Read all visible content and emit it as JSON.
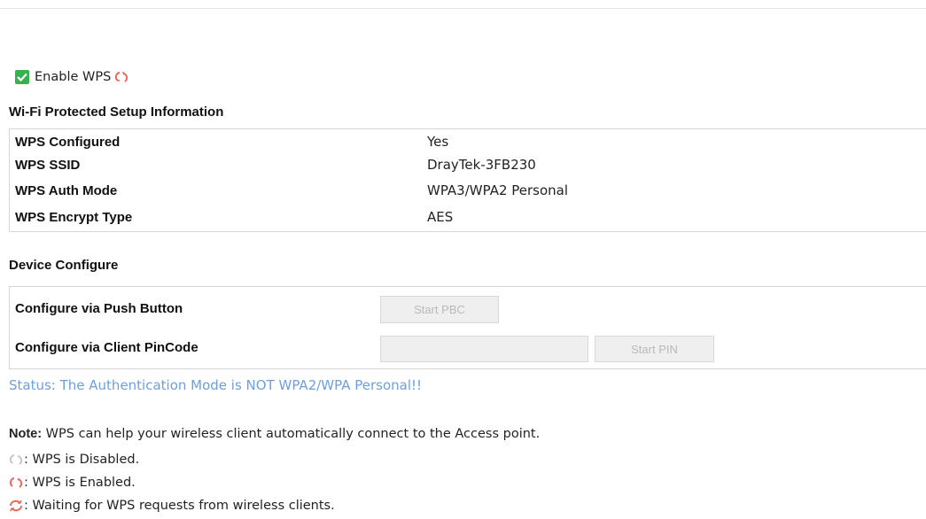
{
  "enable_wps": {
    "label": "Enable WPS",
    "checked": true
  },
  "info_section": {
    "title": "Wi-Fi Protected Setup Information",
    "rows": [
      {
        "label": "WPS Configured",
        "value": "Yes"
      },
      {
        "label": "WPS SSID",
        "value": "DrayTek-3FB230"
      },
      {
        "label": "WPS Auth Mode",
        "value": "WPA3/WPA2 Personal"
      },
      {
        "label": "WPS Encrypt Type",
        "value": "AES"
      }
    ]
  },
  "device_configure": {
    "title": "Device Configure",
    "push_button_label": "Configure via Push Button",
    "pbc_button": "Start PBC",
    "pincode_label": "Configure via Client PinCode",
    "pin_value": "",
    "pin_button": "Start PIN"
  },
  "status": "Status: The Authentication Mode is NOT WPA2/WPA Personal!!",
  "note": {
    "prefix": "Note:",
    "text": " WPS can help your wireless client automatically connect to the Access point."
  },
  "legend": [
    {
      "icon": "wps-disabled-icon",
      "text": ": WPS is Disabled."
    },
    {
      "icon": "wps-enabled-icon",
      "text": ": WPS is Enabled."
    },
    {
      "icon": "wps-waiting-icon",
      "text": ": Waiting for WPS requests from wireless clients."
    }
  ],
  "colors": {
    "check": "#34b24d",
    "status_text": "#6d9fe0",
    "wps_enabled": "#e86a5a",
    "wps_disabled": "#c8c8c8"
  }
}
